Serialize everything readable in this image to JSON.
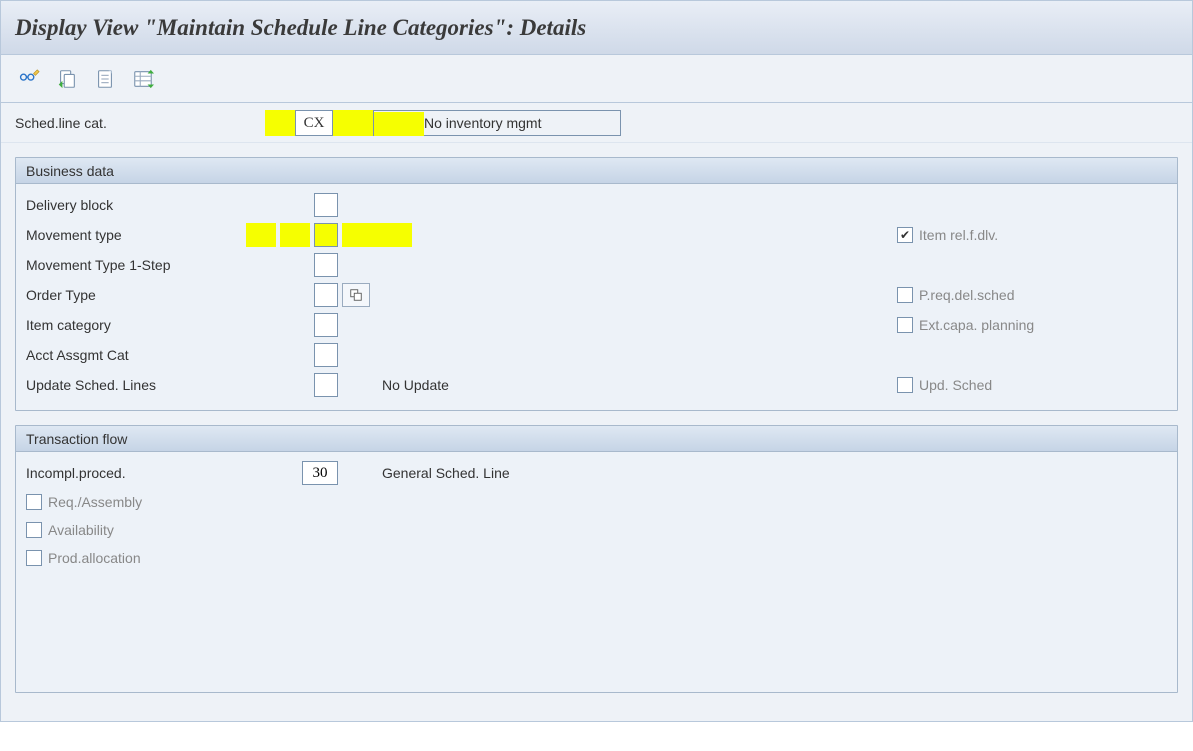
{
  "title": "Display View \"Maintain Schedule Line Categories\": Details",
  "header": {
    "label": "Sched.line cat.",
    "code": "CX",
    "desc": "No inventory mgmt"
  },
  "groups": {
    "business": {
      "title": "Business data",
      "fields": {
        "delivery_block": "Delivery block",
        "movement_type": "Movement type",
        "movement_type_1step": "Movement Type 1-Step",
        "order_type": "Order Type",
        "item_category": "Item category",
        "acct_assgmt_cat": "Acct Assgmt Cat",
        "update_sched_lines": "Update Sched. Lines",
        "update_sched_lines_text": "No Update"
      },
      "right": {
        "item_rel_dlv": "Item rel.f.dlv.",
        "preq_del_sched": "P.req.del.sched",
        "ext_capa_planning": "Ext.capa. planning",
        "upd_sched": "Upd. Sched"
      }
    },
    "transaction": {
      "title": "Transaction flow",
      "fields": {
        "incompl_proced_label": "Incompl.proced.",
        "incompl_proced_value": "30",
        "incompl_proced_text": "General Sched. Line"
      },
      "checkboxes": {
        "req_assembly": "Req./Assembly",
        "availability": "Availability",
        "prod_allocation": "Prod.allocation"
      }
    }
  }
}
